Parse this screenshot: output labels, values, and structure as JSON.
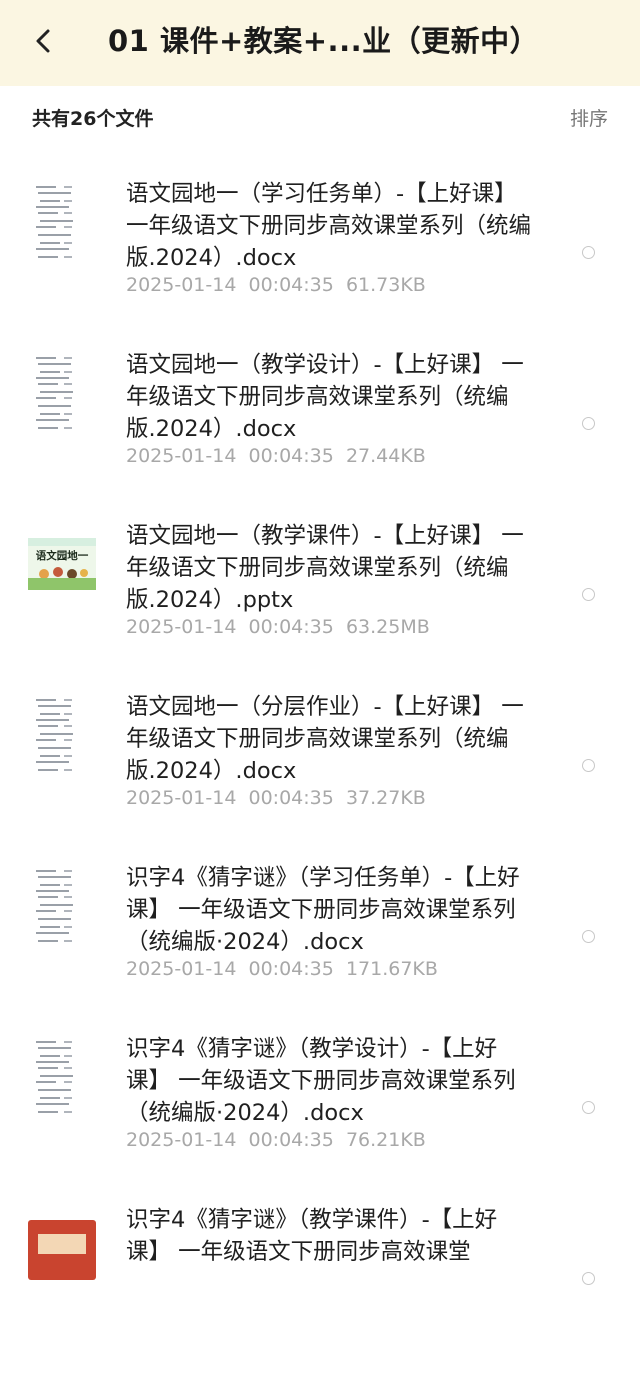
{
  "header": {
    "back_icon": "chevron-left-icon",
    "title": "01 课件+教案+...业（更新中）"
  },
  "toolbar": {
    "file_count": "共有26个文件",
    "sort_label": "排序"
  },
  "files": [
    {
      "name": "语文园地一（学习任务单）-【上好课】 一年级语文下册同步高效课堂系列（统编版.2024）.docx",
      "date": "2025-01-14  00:04:35",
      "size": "61.73KB",
      "thumb": "doc"
    },
    {
      "name": "语文园地一（教学设计）-【上好课】 一年级语文下册同步高效课堂系列（统编版.2024）.docx",
      "date": "2025-01-14  00:04:35",
      "size": "27.44KB",
      "thumb": "doc"
    },
    {
      "name": "语文园地一（教学课件）-【上好课】 一年级语文下册同步高效课堂系列（统编版.2024）.pptx",
      "date": "2025-01-14  00:04:35",
      "size": "63.25MB",
      "thumb": "ppt",
      "thumb_text": "语文园地一"
    },
    {
      "name": "语文园地一（分层作业）-【上好课】 一年级语文下册同步高效课堂系列（统编版.2024）.docx",
      "date": "2025-01-14  00:04:35",
      "size": "37.27KB",
      "thumb": "doc"
    },
    {
      "name": "识字4《猜字谜》（学习任务单）-【上好课】 一年级语文下册同步高效课堂系列（统编版·2024）.docx",
      "date": "2025-01-14  00:04:35",
      "size": "171.67KB",
      "thumb": "doc"
    },
    {
      "name": "识字4《猜字谜》（教学设计）-【上好课】 一年级语文下册同步高效课堂系列（统编版·2024）.docx",
      "date": "2025-01-14  00:04:35",
      "size": "76.21KB",
      "thumb": "doc"
    },
    {
      "name": "识字4《猜字谜》（教学课件）-【上好课】 一年级语文下册同步高效课堂",
      "date": "",
      "size": "",
      "thumb": "ppt-red"
    }
  ],
  "colors": {
    "header_bg": "#fbf6e2",
    "meta_text": "#a8a8a8",
    "radio_border": "#c8c8c8"
  }
}
